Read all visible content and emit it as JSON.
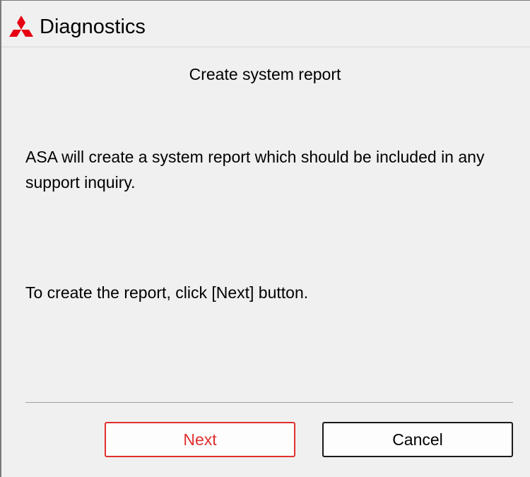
{
  "window": {
    "title": "Diagnostics",
    "logo_icon": "mitsubishi-diamonds-icon",
    "logo_color": "#e60012",
    "background": "#f0f0f0"
  },
  "page": {
    "heading": "Create system report",
    "intro": "ASA will create a system report which should be included in any support inquiry.",
    "instruction": "To create the report, click [Next] button."
  },
  "buttons": {
    "next_label": "Next",
    "next_color": "#e0302f",
    "cancel_label": "Cancel"
  }
}
